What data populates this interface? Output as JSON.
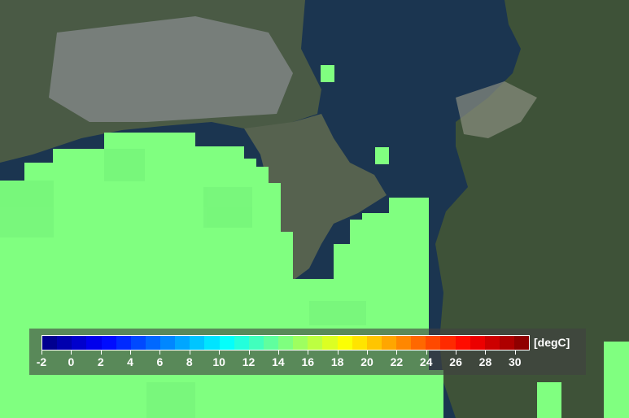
{
  "map": {
    "layer": "sea surface temperature",
    "land_color": "#3c4f3a",
    "urban_color": "#8c8f8d",
    "water_color": "#1b3550",
    "overlay_color": "#80ff80",
    "overlay_value_degC": 16.5
  },
  "colorbar": {
    "unit": "[degC]",
    "min": -2,
    "max": 31,
    "ticks": [
      "-2",
      "0",
      "2",
      "4",
      "6",
      "8",
      "10",
      "12",
      "14",
      "16",
      "18",
      "20",
      "22",
      "24",
      "26",
      "28",
      "30"
    ],
    "tick_values": [
      -2,
      0,
      2,
      4,
      6,
      8,
      10,
      12,
      14,
      16,
      18,
      20,
      22,
      24,
      26,
      28,
      30
    ],
    "colors": [
      "#00007f",
      "#0000ff",
      "#007fff",
      "#00ffff",
      "#7fff7f",
      "#ffff00",
      "#ff7f00",
      "#ff0000",
      "#7f0000"
    ]
  }
}
